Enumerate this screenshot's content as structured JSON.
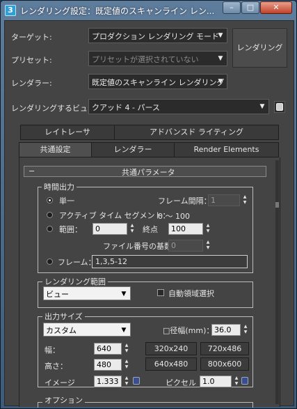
{
  "window": {
    "title": "レンダリング設定：既定値のスキャンライン レン..."
  },
  "caption_buttons": {
    "minimize": "–",
    "maximize": "□",
    "close": "✕"
  },
  "top": {
    "target_label": "ターゲット:",
    "target_value": "プロダクション レンダリング モード",
    "preset_label": "プリセット:",
    "preset_value": "プリセットが選択されていない",
    "renderer_label": "レンダラー:",
    "renderer_value": "既定値のスキャンライン レンダリング",
    "view_label": "レンダリングするビュー:",
    "view_value": "クアッド 4 - パース",
    "render_button": "レンダリング"
  },
  "tabs": {
    "row1": [
      "レイトレーサ",
      "アドバンスド ライティング"
    ],
    "row2": [
      "共通設定",
      "レンダラー",
      "Render Elements"
    ],
    "active": "共通設定"
  },
  "rollout": {
    "collapse": "−",
    "title": "共通パラメータ"
  },
  "time_output": {
    "group_title": "時間出力",
    "single": "単一",
    "frame_interval_label": "フレーム間隔：",
    "frame_interval_value": "1",
    "active_segment": "アクティブ タイム セグメント：",
    "active_segment_range": "0 〜 100",
    "range": "範囲：",
    "range_start": "0",
    "range_end_label": "終点",
    "range_end": "100",
    "file_number_base_label": "ファイル番号の基数：",
    "file_number_base": "0",
    "frames": "フレーム：",
    "frames_value": "1,3,5-12",
    "selected": "単一"
  },
  "render_area": {
    "group_title": "レンダリング範囲",
    "area_value": "ビュー",
    "auto_region_label": "自動領域選択",
    "auto_region_checked": false
  },
  "output_size": {
    "group_title": "出力サイズ",
    "size_preset": "カスタム",
    "aperture_label": "□径幅(mm)：",
    "aperture_value": "36.0",
    "width_label": "幅：",
    "width_value": "640",
    "height_label": "高さ：",
    "height_value": "480",
    "presets": [
      "320x240",
      "720x486",
      "640x480",
      "800x600"
    ],
    "image_aspect_label": "イメージ",
    "image_aspect_value": "1.333",
    "pixel_aspect_label": "ピクセル",
    "pixel_aspect_value": "1.0"
  },
  "options": {
    "group_title": "オプション"
  },
  "icons": {
    "view_lock": "lock-icon",
    "aspect_lock": "lock-icon",
    "app": "3dsmax-icon"
  }
}
